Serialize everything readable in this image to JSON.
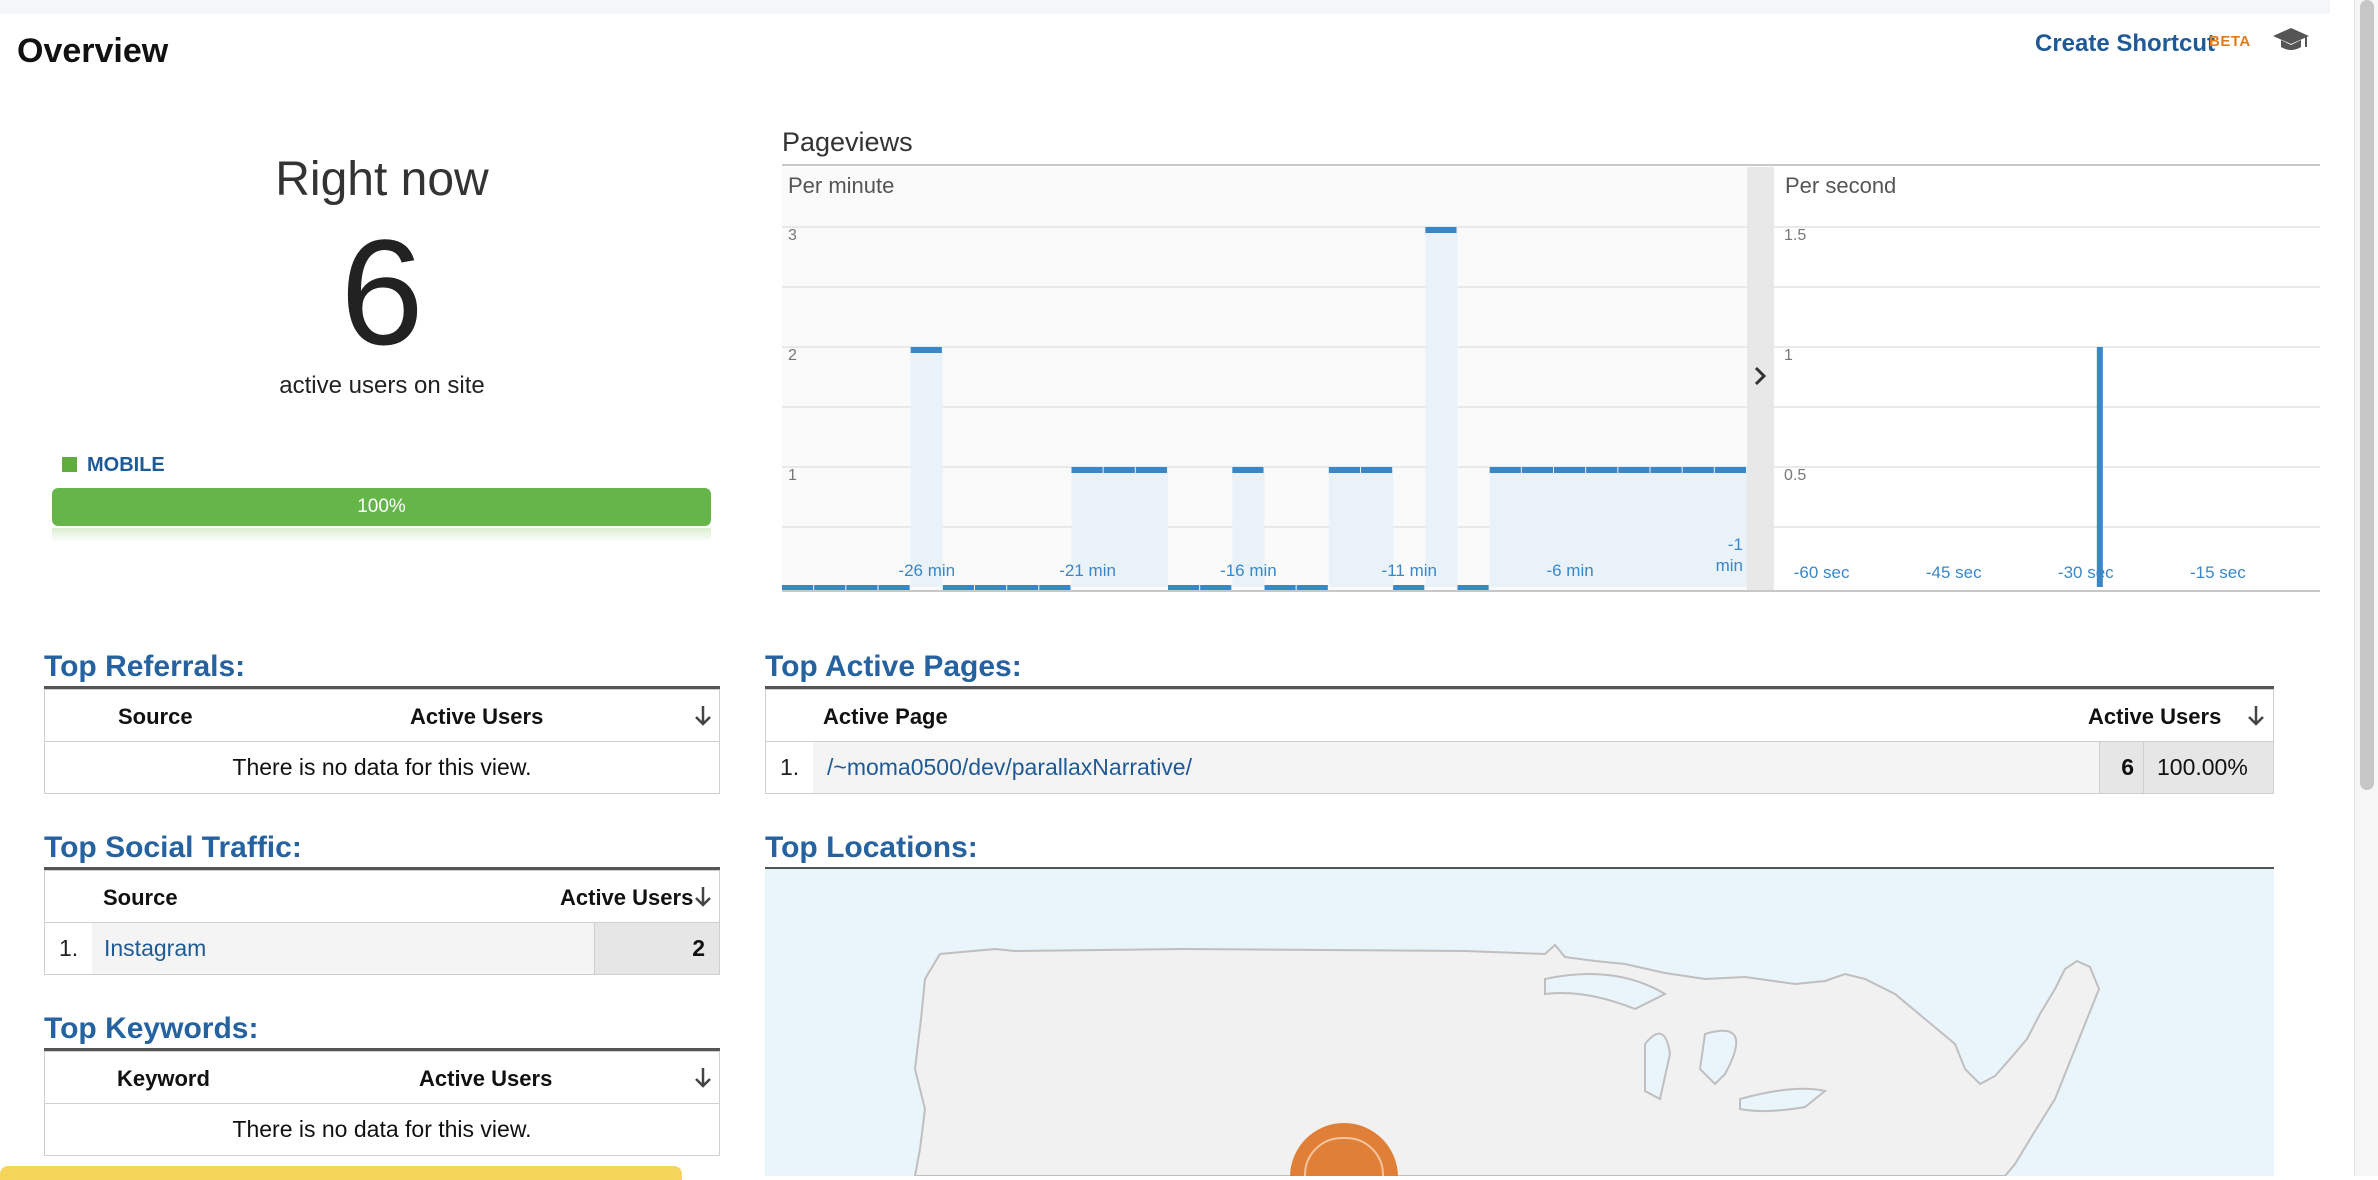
{
  "header": {
    "title": "Overview",
    "create_shortcut": "Create Shortcut",
    "beta": "BETA"
  },
  "right_now": {
    "label": "Right now",
    "count": "6",
    "subtitle": "active users on site",
    "device_label": "MOBILE",
    "device_percent_text": "100%",
    "device_share": 1.0,
    "device_color": "#5fac3f"
  },
  "pageviews": {
    "title": "Pageviews",
    "per_minute_label": "Per minute",
    "per_second_label": "Per second"
  },
  "chart_data": [
    {
      "type": "bar",
      "title": "Per minute",
      "ylim": [
        0,
        3.5
      ],
      "y_ticks": [
        "1",
        "2",
        "3"
      ],
      "x_tick_labels": [
        "-26 min",
        "-21 min",
        "-16 min",
        "-11 min",
        "-6 min",
        "-1 min"
      ],
      "x": [
        -30,
        -29,
        -28,
        -27,
        -26,
        -25,
        -24,
        -23,
        -22,
        -21,
        -20,
        -19,
        -18,
        -17,
        -16,
        -15,
        -14,
        -13,
        -12,
        -11,
        -10,
        -9,
        -8,
        -7,
        -6,
        -5,
        -4,
        -3,
        -2,
        -1
      ],
      "values": [
        0,
        0,
        0,
        0,
        2,
        0,
        0,
        0,
        0,
        1,
        1,
        1,
        0,
        0,
        1,
        0,
        0,
        1,
        1,
        0,
        3,
        0,
        1,
        1,
        1,
        1,
        1,
        1,
        1,
        1
      ],
      "color": "#3a87c8",
      "grid": true
    },
    {
      "type": "bar",
      "title": "Per second",
      "ylim": [
        0,
        1.75
      ],
      "y_ticks": [
        "0.5",
        "1",
        "1.5"
      ],
      "x_tick_labels": [
        "-60 sec",
        "-45 sec",
        "-30 sec",
        "-15 sec"
      ],
      "x": [
        -25
      ],
      "values": [
        1
      ],
      "color": "#3a87c8",
      "grid": true
    }
  ],
  "top_referrals": {
    "title": "Top Referrals:",
    "col_source": "Source",
    "col_users": "Active Users",
    "empty": "There is no data for this view."
  },
  "top_social": {
    "title": "Top Social Traffic:",
    "col_source": "Source",
    "col_users": "Active Users",
    "rows": [
      {
        "index": "1.",
        "source": "Instagram",
        "users": "2"
      }
    ]
  },
  "top_keywords": {
    "title": "Top Keywords:",
    "col_keyword": "Keyword",
    "col_users": "Active Users",
    "empty": "There is no data for this view."
  },
  "top_pages": {
    "title": "Top Active Pages:",
    "col_page": "Active Page",
    "col_users": "Active Users",
    "rows": [
      {
        "index": "1.",
        "page": "/~moma0500/dev/parallaxNarrative/",
        "users": "6",
        "percent": "100.00%"
      }
    ]
  },
  "top_locations": {
    "title": "Top Locations:"
  }
}
